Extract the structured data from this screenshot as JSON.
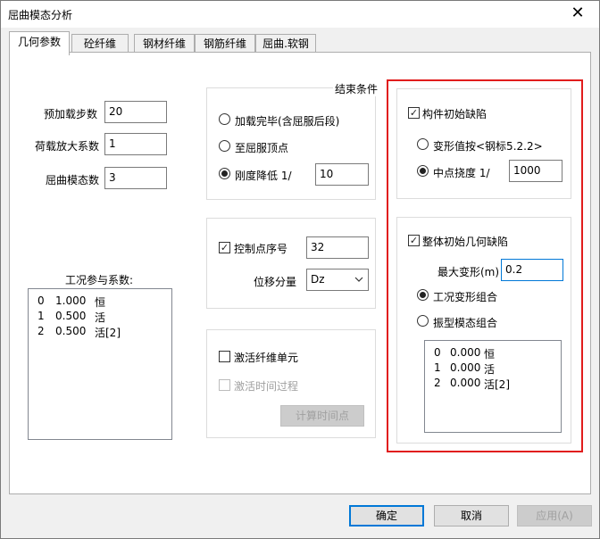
{
  "window": {
    "title": "屈曲模态分析",
    "close_glyph": "✕"
  },
  "tabs": [
    {
      "label": "几何参数",
      "active": true
    },
    {
      "label": "砼纤维"
    },
    {
      "label": "钢材纤维"
    },
    {
      "label": "钢筋纤维"
    },
    {
      "label": "屈曲.软钢"
    }
  ],
  "params": {
    "preload_steps_label": "预加载步数",
    "preload_steps_value": "20",
    "load_factor_label": "荷载放大系数",
    "load_factor_value": "1",
    "buckling_modes_label": "屈曲模态数",
    "buckling_modes_value": "3"
  },
  "end_condition": {
    "title": "结束条件",
    "opt_load_done": "加载完毕(含屈服后段)",
    "opt_yield_top": "至屈服顶点",
    "opt_stiffness": "刚度降低 1/",
    "stiffness_value": "10",
    "selected": "opt_stiffness"
  },
  "control": {
    "checkbox_label": "控制点序号",
    "checked": true,
    "point_value": "32",
    "dof_label": "位移分量",
    "dof_value": "Dz"
  },
  "activate": {
    "fiber_label": "激活纤维单元",
    "time_label": "激活时间过程",
    "calc_button": "计算时间点"
  },
  "cases": {
    "title": "工况参与系数:",
    "rows": [
      {
        "idx": "0",
        "val": "1.000",
        "name": "恒"
      },
      {
        "idx": "1",
        "val": "0.500",
        "name": "活"
      },
      {
        "idx": "2",
        "val": "0.500",
        "name": "活[2]"
      }
    ]
  },
  "member_imperfection": {
    "checkbox_label": "构件初始缺陷",
    "checked": true,
    "opt_code": "变形值按<钢标5.2.2>",
    "opt_mid": "中点挠度 1/",
    "mid_value": "1000",
    "selected": "opt_mid"
  },
  "global_imperfection": {
    "checkbox_label": "整体初始几何缺陷",
    "checked": true,
    "max_def_label": "最大变形(m)",
    "max_def_value": "0.2",
    "opt_case_combo": "工况变形组合",
    "opt_mode_combo": "振型模态组合",
    "selected": "opt_case_combo",
    "rows": [
      {
        "idx": "0",
        "val": "0.000",
        "name": "恒"
      },
      {
        "idx": "1",
        "val": "0.000",
        "name": "活"
      },
      {
        "idx": "2",
        "val": "0.000",
        "name": "活[2]"
      }
    ]
  },
  "buttons": {
    "ok": "确定",
    "cancel": "取消",
    "apply": "应用(A)"
  },
  "colors": {
    "highlight": "#e11d1d",
    "focus": "#0078d7"
  }
}
